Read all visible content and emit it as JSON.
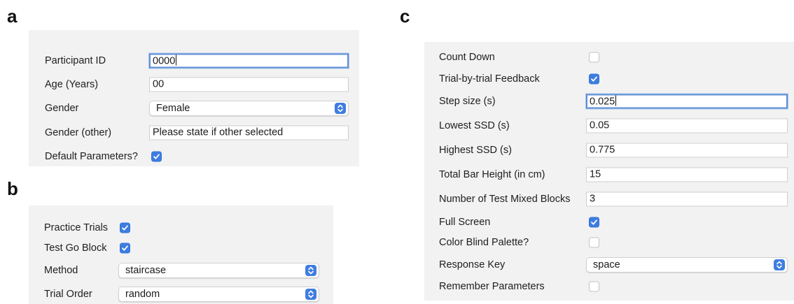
{
  "panels": {
    "a": {
      "letter": "a",
      "participant_id": {
        "label": "Participant ID",
        "value": "0000"
      },
      "age": {
        "label": "Age (Years)",
        "value": "00"
      },
      "gender": {
        "label": "Gender",
        "value": "Female"
      },
      "gender_other": {
        "label": "Gender (other)",
        "value": "Please state if other selected"
      },
      "default_parameters": {
        "label": "Default Parameters?",
        "checked": true
      }
    },
    "b": {
      "letter": "b",
      "practice_trials": {
        "label": "Practice Trials",
        "checked": true
      },
      "test_go_block": {
        "label": "Test Go Block",
        "checked": true
      },
      "method": {
        "label": "Method",
        "value": "staircase"
      },
      "trial_order": {
        "label": "Trial Order",
        "value": "random"
      }
    },
    "c": {
      "letter": "c",
      "count_down": {
        "label": "Count Down",
        "checked": false
      },
      "trial_feedback": {
        "label": "Trial-by-trial Feedback",
        "checked": true
      },
      "step_size": {
        "label": "Step size (s)",
        "value": "0.025"
      },
      "lowest_ssd": {
        "label": "Lowest SSD (s)",
        "value": "0.05"
      },
      "highest_ssd": {
        "label": "Highest SSD (s)",
        "value": "0.775"
      },
      "bar_height": {
        "label": "Total Bar Height (in cm)",
        "value": "15"
      },
      "mixed_blocks": {
        "label": "Number of Test Mixed Blocks",
        "value": "3"
      },
      "full_screen": {
        "label": "Full Screen",
        "checked": true
      },
      "color_blind": {
        "label": "Color Blind Palette?",
        "checked": false
      },
      "response_key": {
        "label": "Response Key",
        "value": "space"
      },
      "remember_parameters": {
        "label": "Remember Parameters",
        "checked": false
      }
    }
  },
  "colors": {
    "panel_bg": "#f2f2f2",
    "accent": "#3d7de0",
    "focus_ring": "#5f8fd6"
  }
}
